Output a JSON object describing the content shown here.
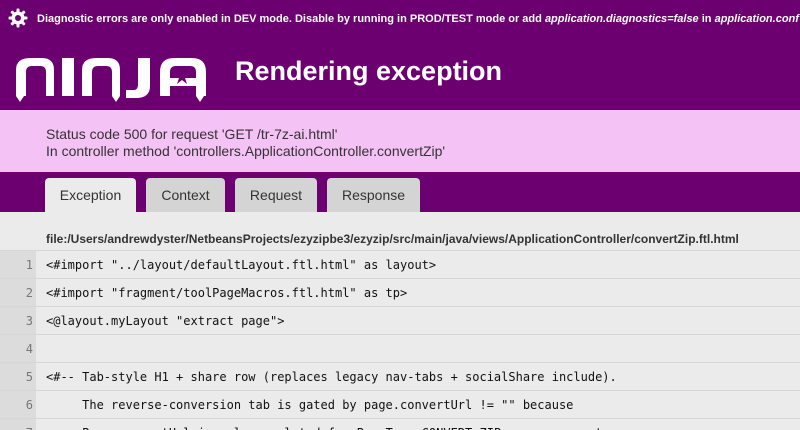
{
  "notice": {
    "prefix": "Diagnostic errors are only enabled in DEV mode. Disable by running in PROD/TEST mode or add ",
    "setting": "application.diagnostics=false",
    "middle": " in ",
    "file": "application.conf"
  },
  "header": {
    "logo_text": "NINJA",
    "title": "Rendering exception"
  },
  "status": {
    "line1": "Status code 500 for request 'GET /tr-7z-ai.html'",
    "line2": "In controller method 'controllers.ApplicationController.convertZip'"
  },
  "tabs": [
    {
      "label": "Exception",
      "active": true
    },
    {
      "label": "Context",
      "active": false
    },
    {
      "label": "Request",
      "active": false
    },
    {
      "label": "Response",
      "active": false
    }
  ],
  "file_path": "file:/Users/andrewdyster/NetbeansProjects/ezyzipbe3/ezyzip/src/main/java/views/ApplicationController/convertZip.ftl.html",
  "code_lines": [
    {
      "num": "1",
      "text": "<#import \"../layout/defaultLayout.ftl.html\" as layout>"
    },
    {
      "num": "2",
      "text": "<#import \"fragment/toolPageMacros.ftl.html\" as tp>"
    },
    {
      "num": "3",
      "text": "<@layout.myLayout \"extract page\">"
    },
    {
      "num": "4",
      "text": ""
    },
    {
      "num": "5",
      "text": "<#-- Tab-style H1 + share row (replaces legacy nav-tabs + socialShare include)."
    },
    {
      "num": "6",
      "text": "     The reverse-conversion tab is gated by page.convertUrl != \"\" because"
    },
    {
      "num": "7",
      "text": "     Page.convertUrl is only populated for PageType.CONVERT_ZIP source — empty"
    }
  ],
  "colors": {
    "brand": "#6c0070",
    "status_bg": "#f5c2f5",
    "page_bg": "#ebebeb"
  }
}
